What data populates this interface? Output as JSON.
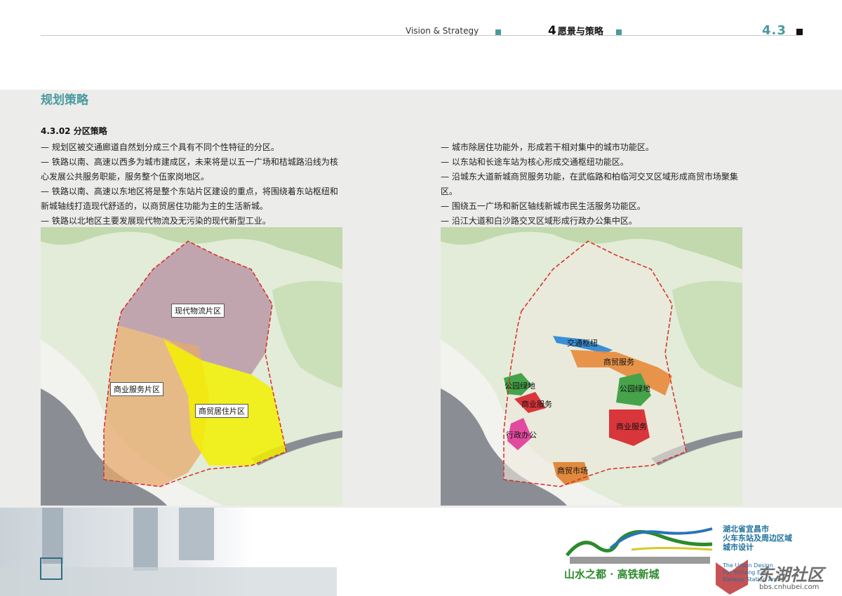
{
  "header": {
    "section_en": "Vision & Strategy",
    "chapter_num": "4",
    "chapter_title": "愿景与策略",
    "page_num": "4.3",
    "accent_color": "#4a9aa0"
  },
  "title": "规划策略",
  "subtitle": "4.3.02 分区策略",
  "left_lines": [
    "— 规划区被交通廊道自然划分成三个具有不同个性特征的分区。",
    "— 铁路以南、高速以西多为城市建成区，未来将是以五一广场和桔城路沿线为核",
    "心发展公共服务职能，服务整个伍家岗地区。",
    "— 铁路以南、高速以东地区将是整个东站片区建设的重点，将围绕着东站枢纽和",
    "新城轴线打造现代舒适的，以商贸居住功能为主的生活新城。",
    "— 铁路以北地区主要发展现代物流及无污染的现代新型工业。"
  ],
  "right_lines": [
    "— 城市除居住功能外，形成若干相对集中的城市功能区。",
    "— 以东站和长途车站为核心形成交通枢纽功能区。",
    "— 沿城东大道新城商贸服务功能，在武临路和柏临河交叉区域形成商贸市场聚集",
    "区。",
    "— 围绕五一广场和新区轴线新城市民生活服务功能区。",
    "— 沿江大道和白沙路交叉区域形成行政办公集中区。"
  ],
  "map1_zones": {
    "logistics": "现代物流片区",
    "commercial": "商业服务片区",
    "residential": "商贸居住片区"
  },
  "map2_functions": {
    "transport_hub": "交通枢纽",
    "trade_service": "商贸服务",
    "park_west": "公园绿地",
    "park_east": "公园绿地",
    "commerce_west": "商业服务",
    "commerce_east": "商业服务",
    "admin": "行政办公",
    "market": "商贸市场"
  },
  "colors": {
    "logistics": "#b58ea0",
    "commercial": "#e7a96c",
    "residential": "#f2f000",
    "transport": "#3a8fd6",
    "trade": "#e88a3a",
    "park": "#46a34a",
    "commerce": "#d9363b",
    "admin": "#e24aa0",
    "market": "#e08a3e",
    "boundary": "#d92a2a"
  },
  "brand": {
    "city_lines": [
      "湖北省宜昌市",
      "火车东站及周边区域",
      "城市设计"
    ],
    "en_lines": [
      "The Urban Design",
      "For Yichang East",
      "Railway Station Area"
    ],
    "slogan": "山水之都 · 高铁新城"
  },
  "watermark": {
    "name": "东湖社区",
    "url": "bbs.cnhubei.com"
  }
}
